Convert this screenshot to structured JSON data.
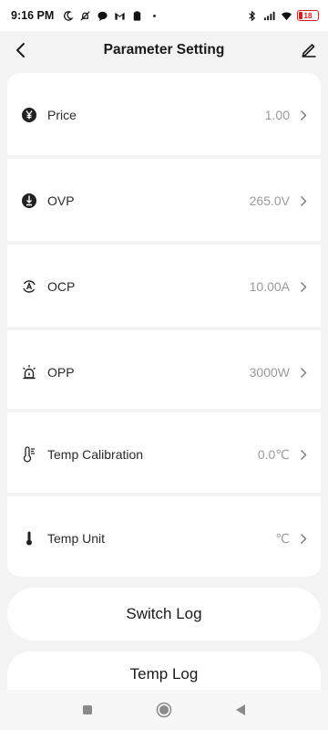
{
  "status_bar": {
    "time": "9:16 PM",
    "battery": "18",
    "left_icons": [
      "moon-icon",
      "notifications-off-icon",
      "chat-icon",
      "gmail-icon",
      "clipboard-icon"
    ],
    "right_icons": [
      "bluetooth-icon",
      "signal-icon",
      "wifi-icon",
      "battery-icon"
    ]
  },
  "header": {
    "title": "Parameter Setting",
    "back_icon": "chevron-left-icon",
    "edit_icon": "pencil-icon"
  },
  "settings": [
    {
      "key": "price",
      "label": "Price",
      "value": "1.00",
      "icon": "yen-icon"
    },
    {
      "key": "ovp",
      "label": "OVP",
      "value": "265.0V",
      "icon": "voltage-icon"
    },
    {
      "key": "ocp",
      "label": "OCP",
      "value": "10.00A",
      "icon": "current-icon"
    },
    {
      "key": "opp",
      "label": "OPP",
      "value": "3000W",
      "icon": "alarm-icon"
    },
    {
      "key": "temp-calibration",
      "label": "Temp Calibration",
      "value": "0.0℃",
      "icon": "thermometer-calibration-icon"
    },
    {
      "key": "temp-unit",
      "label": "Temp Unit",
      "value": "℃",
      "icon": "thermometer-icon"
    }
  ],
  "buttons": {
    "switch_log": "Switch Log",
    "temp_log": "Temp Log"
  },
  "nav": {
    "icons": [
      "recent-apps-icon",
      "home-icon",
      "back-icon"
    ]
  },
  "colors": {
    "background": "#f3f3f3",
    "card": "#ffffff",
    "value_text": "#9a9a9a",
    "battery_low": "#d02020"
  }
}
